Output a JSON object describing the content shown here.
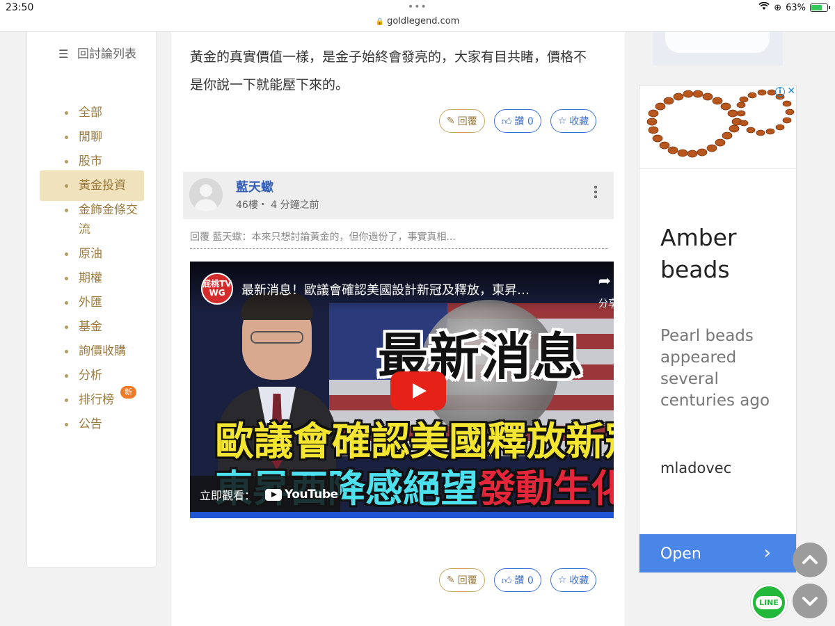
{
  "status": {
    "time": "23:50",
    "url": "goldlegend.com",
    "battery": "63%"
  },
  "sidebar": {
    "title": "回討論列表",
    "items": [
      {
        "label": "全部"
      },
      {
        "label": "閒聊"
      },
      {
        "label": "股市"
      },
      {
        "label": "黃金投資",
        "active": true
      },
      {
        "label": "金飾金條交流"
      },
      {
        "label": "原油"
      },
      {
        "label": "期權"
      },
      {
        "label": "外匯"
      },
      {
        "label": "基金"
      },
      {
        "label": "詢價收購"
      },
      {
        "label": "分析"
      },
      {
        "label": "排行榜",
        "badge": "新"
      },
      {
        "label": "公告"
      }
    ]
  },
  "post_prev": {
    "text_line1": "黃金的真實價值一樣，是金子始終會發亮的，大家有目共睹，價格不",
    "text_line2": "是你說一下就能壓下來的。"
  },
  "actions": {
    "reply": "回覆",
    "likes": "讚 0",
    "favorite": "收藏"
  },
  "reply_post": {
    "author": "藍天蠍",
    "meta": "46樓・ 4 分鐘之前",
    "quote": "回覆 藍天蠍：本來只想討論黃金的，但你過份了，事實真相..."
  },
  "video": {
    "channel_logo": "屁桃TV WG",
    "title": "最新消息！歐議會確認美國設計新冠及釋放，東昇…",
    "share_label": "分享",
    "headline1": "最新消息",
    "headline2": "歐議會確認美國釋放新冠",
    "headline3a": "東昇西降感絕望",
    "headline3b": "發動生化戰",
    "watch_on": "立即觀看：",
    "yt_brand": "YouTube"
  },
  "ad": {
    "headline": "Amber beads",
    "description": "Pearl beads appeared several centuries ago",
    "brand": "mladovec",
    "cta": "Open",
    "info_icon": "i",
    "close_icon": "✕"
  },
  "floating": {
    "line_label": "LINE"
  },
  "colors": {
    "gold_text": "#9a7a3d",
    "active_bg": "#efe2bd",
    "link_blue": "#3560b5",
    "ad_button": "#4a86e8"
  }
}
